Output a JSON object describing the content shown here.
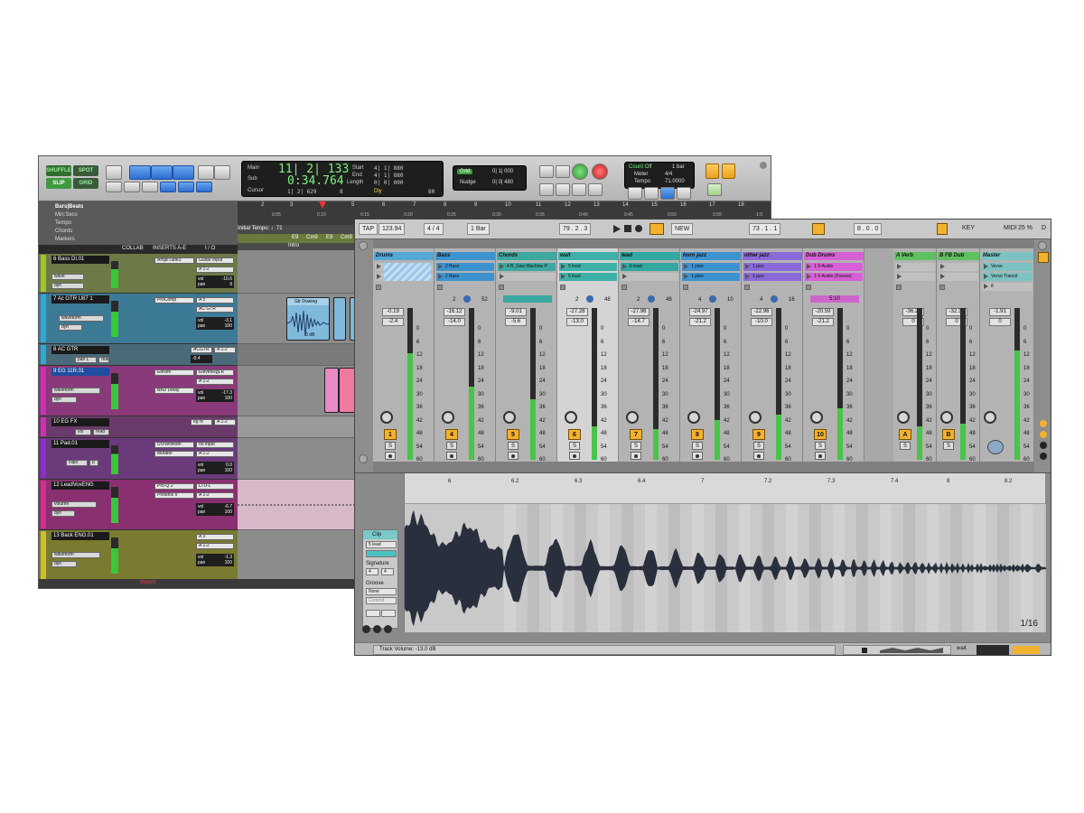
{
  "protools": {
    "edit_modes": {
      "shuffle": "SHUFFLE",
      "spot": "SPOT",
      "slip": "SLIP",
      "grid": "GRID"
    },
    "counter": {
      "main_label": "Main",
      "sub_label": "Sub",
      "cursor_label": "Cursor",
      "main": "11| 2| 133",
      "sub": "0:34.764",
      "start_label": "Start",
      "end_label": "End",
      "length_label": "Length",
      "start": "4| 1| 880",
      "end": "4| 1| 880",
      "length": "0| 0| 000",
      "cursor": "1| 2| 629",
      "cursor_extra": "8",
      "dly_label": "Dly",
      "tempo_val": "80"
    },
    "grid_box": {
      "grid_label": "Grid",
      "grid_val": "0| 1| 000",
      "nudge_label": "Nudge",
      "nudge_val": "0| 0| 480"
    },
    "count_box": {
      "count_off": "Count Off",
      "meter": "Meter",
      "tempo": "Tempo",
      "bar": "1 bar",
      "meter_val": "4/4",
      "tempo_val": "71.0000"
    },
    "ruler_rows": [
      "Bars|Beats",
      "Min:Secs",
      "Tempo",
      "Chords",
      "Markers"
    ],
    "ruler_bars": [
      "2",
      "3",
      "4",
      "5",
      "6",
      "7",
      "8",
      "9",
      "10",
      "11",
      "12",
      "13",
      "14",
      "15",
      "16",
      "17",
      "18"
    ],
    "ruler_secs": [
      "0:05",
      "0:10",
      "0:15",
      "0:20",
      "0:25",
      "0:30",
      "0:35",
      "0:40",
      "0:45",
      "0:50",
      "0:55",
      "1:0"
    ],
    "tempo_text": "Initial Tempo: ♩71",
    "chords": [
      "E9",
      "Cm9",
      "E9",
      "Cm9",
      "E9"
    ],
    "marker_text": "Intro",
    "col_headers": {
      "collab": "COLLAB",
      "inserts": "INSERTS A-E",
      "io": "I / O"
    },
    "tracks": [
      {
        "num": "6",
        "name": "Bass DI.01",
        "mode": "wave",
        "view": "dyn",
        "ins1": "AmpliTube3",
        "io1": "Guitar Input",
        "io2": "A 1-2",
        "vol": "-10.6",
        "pan": "9"
      },
      {
        "num": "7",
        "name": "Ac GTR U87 1",
        "mode": "waveform",
        "view": "dyn",
        "ins1": "ProComp",
        "io1": "A 5",
        "io2": "AC GTR",
        "vol": "-3.1",
        "pan": "100"
      },
      {
        "num": "8",
        "name": "AC GTR",
        "mode": "pan L",
        "view": "read",
        "ins1": "",
        "io1": "ACGTR",
        "io2": "A 1-2",
        "vol": "-0.4",
        "pan": ""
      },
      {
        "num": "9",
        "name": "EG 11R.01",
        "mode": "waveform",
        "view": "dyn",
        "ins1": "Eleven",
        "io1": "ElevenRgLR",
        "io2": "A 1-2",
        "vol": "-17.3",
        "pan": "100"
      },
      {
        "num": "10",
        "name": "EG FX",
        "mode": "vol",
        "view": "read",
        "ins1": "eg fx",
        "io1": "A 1-2",
        "io2": "",
        "vol": "",
        "pan": ""
      },
      {
        "num": "11",
        "name": "Pad.01",
        "mode": "clips",
        "view": "p",
        "ins1": "UVIWorkstn",
        "io1": "no input",
        "io2": "A 1-2",
        "vol": "0.0",
        "pan": "100"
      },
      {
        "num": "12",
        "name": "LeadVoxENG",
        "mode": "volume",
        "view": "dyn",
        "ins1": "Pro-Q 2",
        "io1": "LTD-L",
        "io2": "A 1-2",
        "vol": "-6.7",
        "pan": "100"
      },
      {
        "num": "13",
        "name": "Back ENG.01",
        "mode": "waveform",
        "view": "dyn",
        "ins1": "",
        "io1": "A 3",
        "io2": "A 1-2",
        "vol": "-1.3",
        "pan": "100"
      }
    ],
    "inserts2": {
      "t4": "BBD Delay",
      "t6": "Mutator",
      "t7": "Phoenix II"
    },
    "clip_label": "Gtr Dowing",
    "clip_gain": "0 dB",
    "footer": "Import"
  },
  "ableton": {
    "top": {
      "tap": "TAP",
      "bpm": "123.94",
      "sig": "4 / 4",
      "quant": "1 Bar",
      "pos": "79 .  2 .  3",
      "new": "NEW",
      "loop_start": "73 .  1 .  1",
      "loop_len": "8 .  0 .  0",
      "key": "KEY",
      "midi": "MIDI",
      "cpu": "25 %",
      "d": "D"
    },
    "channels": [
      {
        "name": "Drums",
        "color": "#55a8d6",
        "slot1": "",
        "slot2": "",
        "db1": "-0.19",
        "db2": "-2.4",
        "num": "1",
        "fill": 70
      },
      {
        "name": "Bass",
        "color": "#3d92d0",
        "slot1": "2 Bass",
        "slot2": "2 Bass",
        "db1": "-16.12",
        "db2": "-14.0",
        "num": "4",
        "fill": 48,
        "s1": "2",
        "s2": "52"
      },
      {
        "name": "Chords",
        "color": "#3da8a0",
        "slot1": "4 B_Saw Machine P",
        "slot2": "",
        "db1": "-9.01",
        "db2": "-5.6",
        "num": "5",
        "fill": 40
      },
      {
        "name": "wait",
        "color": "#3db0a8",
        "slot1": "5 lead",
        "slot2": "5 lead",
        "db1": "-27.28",
        "db2": "-13.0",
        "num": "6",
        "fill": 22,
        "s1": "2",
        "s2": "48"
      },
      {
        "name": "lead",
        "color": "#30a8a0",
        "slot1": "6 lead",
        "slot2": "",
        "db1": "-27.96",
        "db2": "-14.7",
        "num": "7",
        "fill": 20,
        "s1": "2",
        "s2": "48"
      },
      {
        "name": "horn jazz",
        "color": "#3d92d0",
        "slot1": "1 plan",
        "slot2": "1 plan",
        "db1": "-24.97",
        "db2": "-21.2",
        "num": "8",
        "fill": 26,
        "s1": "4",
        "s2": "10"
      },
      {
        "name": "other jazz",
        "color": "#8a6ad8",
        "slot1": "1 jazz",
        "slot2": "1 jazz",
        "db1": "-22.96",
        "db2": "-10.0",
        "num": "9",
        "fill": 30,
        "s1": "4",
        "s2": "16"
      },
      {
        "name": "Dub Drums",
        "color": "#d660d6",
        "slot1": "1 9-Audio",
        "slot2": "1 9-Audio (Freeze)",
        "db1": "-20.59",
        "db2": "-21.2",
        "num": "10",
        "fill": 34,
        "s3": "5:10"
      },
      {
        "name": "A Verb",
        "color": "#5fc05f",
        "slot1": "",
        "slot2": "",
        "db1": "-36.24",
        "db2": "0",
        "num": "A",
        "fill": 22
      },
      {
        "name": "B FB Dub",
        "color": "#5fc05f",
        "slot1": "",
        "slot2": "",
        "db1": "-32.32",
        "db2": "0",
        "num": "B",
        "fill": 24
      },
      {
        "name": "Master",
        "color": "#7cc2c2",
        "slot1": "Verse",
        "slot2": "Verse Transit",
        "slot3": "8",
        "db1": "-1.91",
        "db2": "0",
        "num": "",
        "fill": 72
      }
    ],
    "scale": [
      "0",
      "6",
      "12",
      "18",
      "24",
      "30",
      "36",
      "42",
      "48",
      "54",
      "60"
    ],
    "clip": {
      "title": "Clip",
      "name": "5 lead",
      "signature": "Signature",
      "sig_n": "4",
      "sig_d": "4",
      "groove": "Groove",
      "groove_val": "None",
      "commit": "Commit"
    },
    "wave_markers": [
      "6",
      "6.2",
      "6.3",
      "6.4",
      "7",
      "7.2",
      "7.3",
      "7.4",
      "8",
      "8.2"
    ],
    "page": "1/16",
    "status": "Track Volume: -13.0 dB",
    "bottom": {
      "mode": "wait"
    }
  }
}
